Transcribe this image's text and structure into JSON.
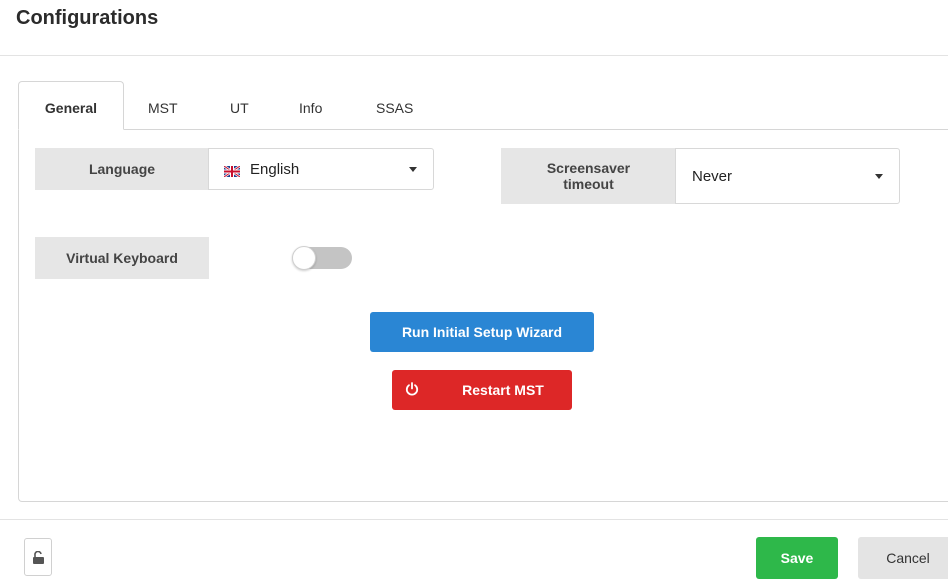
{
  "page": {
    "title": "Configurations"
  },
  "tabs": [
    {
      "label": "General",
      "active": true
    },
    {
      "label": "MST"
    },
    {
      "label": "UT"
    },
    {
      "label": "Info"
    },
    {
      "label": "SSAS"
    }
  ],
  "general": {
    "language": {
      "label": "Language",
      "value": "English",
      "icon": "uk-flag-icon"
    },
    "screensaver": {
      "label": "Screensaver timeout",
      "value": "Never"
    },
    "virtual_keyboard": {
      "label": "Virtual Keyboard",
      "enabled": false
    },
    "wizard_button": "Run Initial Setup Wizard",
    "restart_button": {
      "label": "Restart MST",
      "icon": "power-icon"
    }
  },
  "footer": {
    "lock_icon": "unlock-icon",
    "save_label": "Save",
    "cancel_label": "Cancel"
  },
  "colors": {
    "primary": "#2a86d4",
    "danger": "#dd2727",
    "success": "#2eb84a",
    "neutral": "#e4e4e4"
  }
}
